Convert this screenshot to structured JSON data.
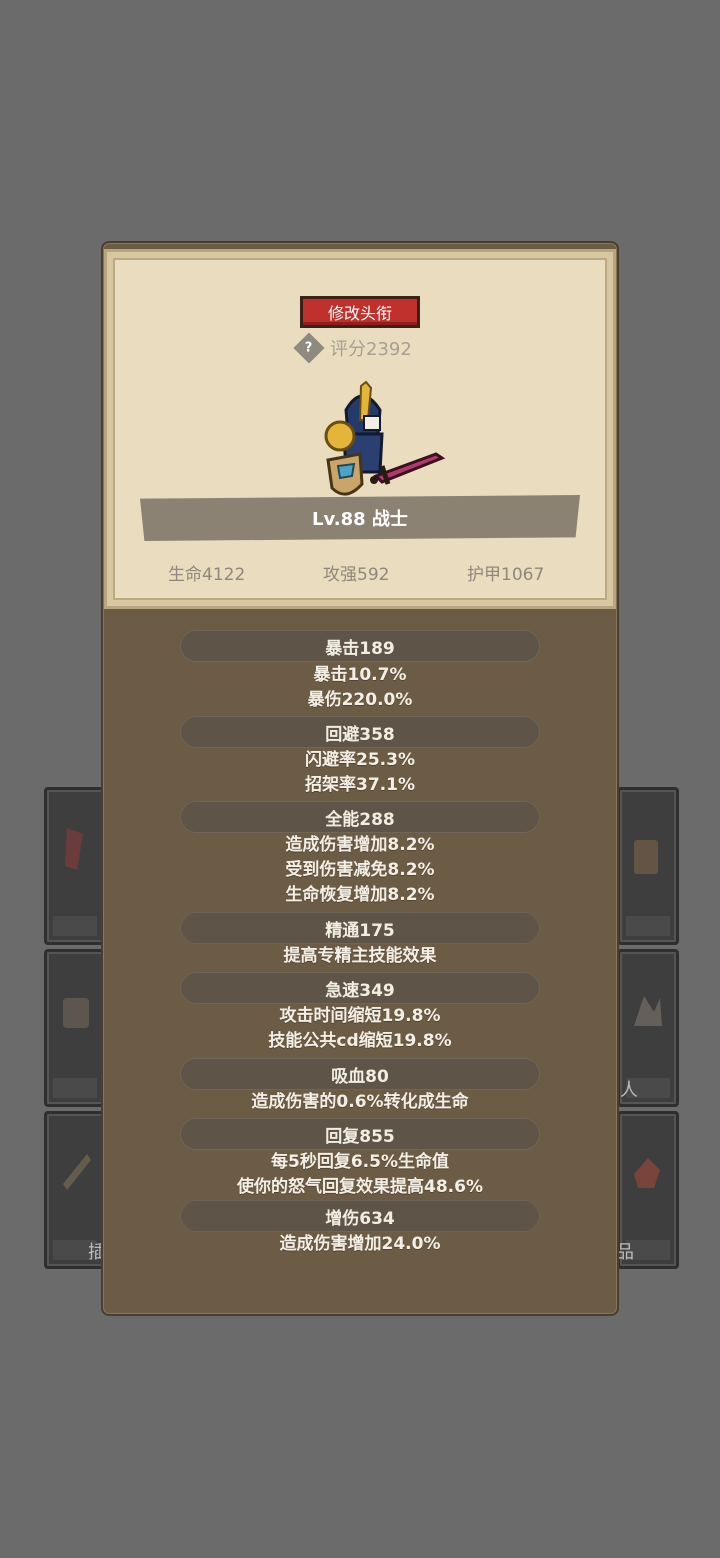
{
  "card": {
    "rename_button": "修改头衔",
    "score": "评分2392",
    "level_class": "Lv.88 战士",
    "summary": {
      "hp": "生命4122",
      "attack": "攻强592",
      "armor": "护甲1067"
    }
  },
  "attributes": [
    {
      "header": "暴击189",
      "lines": [
        "暴击10.7%",
        "暴伤220.0%"
      ]
    },
    {
      "header": "回避358",
      "lines": [
        "闪避率25.3%",
        "招架率37.1%"
      ]
    },
    {
      "header": "全能288",
      "lines": [
        "造成伤害增加8.2%",
        "受到伤害减免8.2%",
        "生命恢复增加8.2%"
      ]
    },
    {
      "header": "精通175",
      "lines": [
        "提高专精主技能效果"
      ]
    },
    {
      "header": "急速349",
      "lines": [
        "攻击时间缩短19.8%",
        "技能公共cd缩短19.8%"
      ]
    },
    {
      "header": "吸血80",
      "lines": [
        "造成伤害的0.6%转化成生命"
      ]
    },
    {
      "header": "回复855",
      "lines": [
        "每5秒回复6.5%生命值",
        "使你的怒气回复效果提高48.6%"
      ]
    },
    {
      "header": "增伤634",
      "lines": [
        "造成伤害增加24.0%"
      ]
    }
  ],
  "background": {
    "tile_label_right_mid": "人",
    "tile_label_left_bottom": "插",
    "tile_label_right_bottom": "品"
  },
  "colors": {
    "accent_red": "#c0312e",
    "panel_brown": "#6c5b45",
    "card_parchment": "#e9dcbf"
  }
}
